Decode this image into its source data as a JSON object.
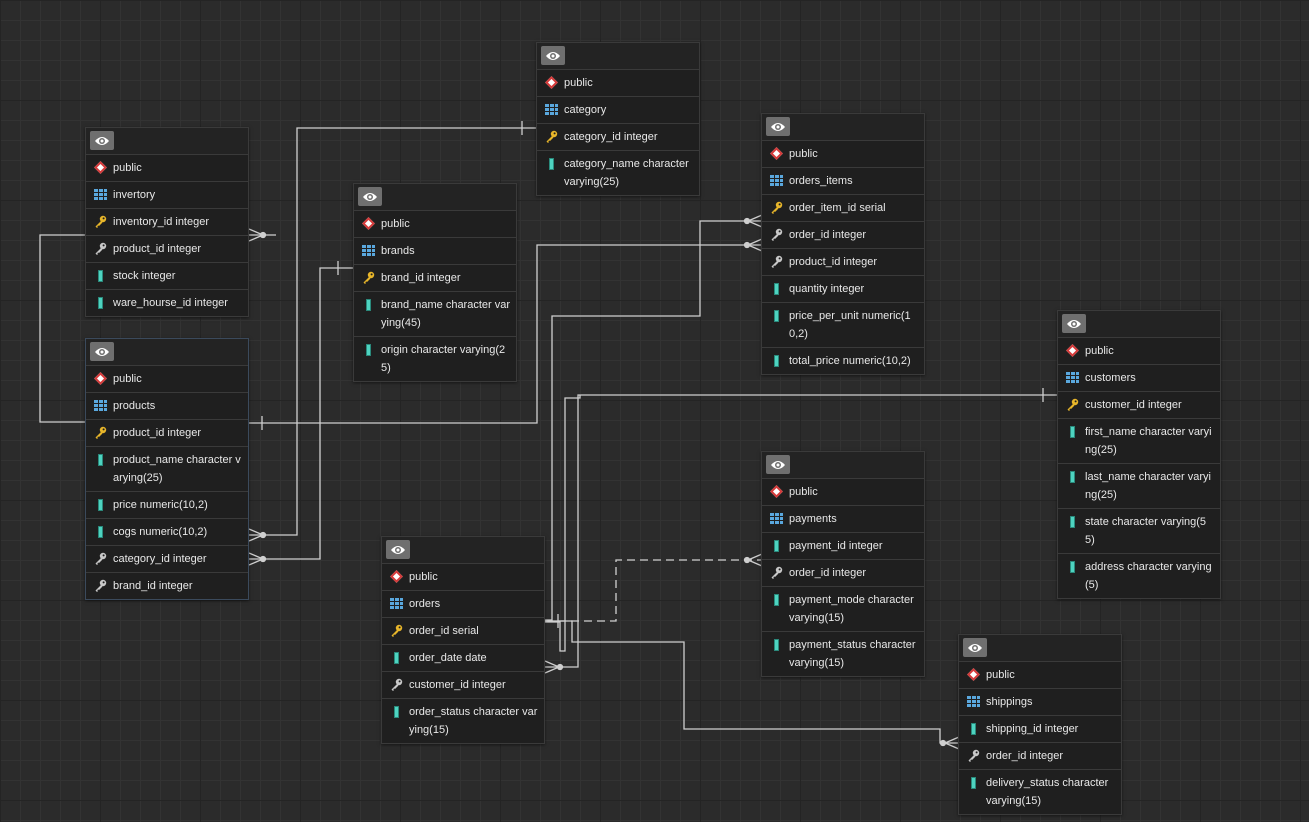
{
  "schema": "public",
  "colors": {
    "background": "#2b2b2b",
    "link": "#cfcfcf",
    "pk_key": "#e8b62a",
    "fk_key": "#c9c9c9",
    "column": "#4ed3c0",
    "table_icon": "#5aa8de",
    "schema_icon": "#d63b3b"
  },
  "tables": {
    "inventory": {
      "name": "invertory",
      "columns": [
        {
          "text": "inventory_id integer",
          "kind": "pk"
        },
        {
          "text": "product_id integer",
          "kind": "fk"
        },
        {
          "text": "stock integer",
          "kind": "col"
        },
        {
          "text": "ware_hourse_id integer",
          "kind": "col"
        }
      ]
    },
    "products": {
      "name": "products",
      "columns": [
        {
          "text": "product_id integer",
          "kind": "pk"
        },
        {
          "text": "product_name character varying(25)",
          "kind": "col"
        },
        {
          "text": "price numeric(10,2)",
          "kind": "col"
        },
        {
          "text": "cogs numeric(10,2)",
          "kind": "col"
        },
        {
          "text": "category_id integer",
          "kind": "fk"
        },
        {
          "text": "brand_id integer",
          "kind": "fk"
        }
      ]
    },
    "brands": {
      "name": "brands",
      "columns": [
        {
          "text": "brand_id integer",
          "kind": "pk"
        },
        {
          "text": "brand_name character varying(45)",
          "kind": "col"
        },
        {
          "text": "origin character varying(25)",
          "kind": "col"
        }
      ]
    },
    "category": {
      "name": "category",
      "columns": [
        {
          "text": "category_id integer",
          "kind": "pk"
        },
        {
          "text": "category_name character varying(25)",
          "kind": "col"
        }
      ]
    },
    "orders_items": {
      "name": "orders_items",
      "columns": [
        {
          "text": "order_item_id serial",
          "kind": "pk"
        },
        {
          "text": "order_id integer",
          "kind": "fk"
        },
        {
          "text": "product_id integer",
          "kind": "fk"
        },
        {
          "text": "quantity integer",
          "kind": "col"
        },
        {
          "text": "price_per_unit numeric(10,2)",
          "kind": "col"
        },
        {
          "text": "total_price numeric(10,2)",
          "kind": "col"
        }
      ]
    },
    "customers": {
      "name": "customers",
      "columns": [
        {
          "text": "customer_id integer",
          "kind": "pk"
        },
        {
          "text": "first_name character varying(25)",
          "kind": "col"
        },
        {
          "text": "last_name character varying(25)",
          "kind": "col"
        },
        {
          "text": "state character varying(55)",
          "kind": "col"
        },
        {
          "text": "address character varying(5)",
          "kind": "col"
        }
      ]
    },
    "payments": {
      "name": "payments",
      "columns": [
        {
          "text": "payment_id integer",
          "kind": "col"
        },
        {
          "text": "order_id integer",
          "kind": "fk"
        },
        {
          "text": "payment_mode character varying(15)",
          "kind": "col"
        },
        {
          "text": "payment_status character varying(15)",
          "kind": "col"
        }
      ]
    },
    "orders": {
      "name": "orders",
      "columns": [
        {
          "text": "order_id serial",
          "kind": "pk"
        },
        {
          "text": "order_date date",
          "kind": "col"
        },
        {
          "text": "customer_id integer",
          "kind": "fk"
        },
        {
          "text": "order_status character varying(15)",
          "kind": "col"
        }
      ]
    },
    "shippings": {
      "name": "shippings",
      "columns": [
        {
          "text": "shipping_id integer",
          "kind": "col"
        },
        {
          "text": "order_id integer",
          "kind": "fk"
        },
        {
          "text": "delivery_status character varying(15)",
          "kind": "col"
        }
      ]
    }
  }
}
